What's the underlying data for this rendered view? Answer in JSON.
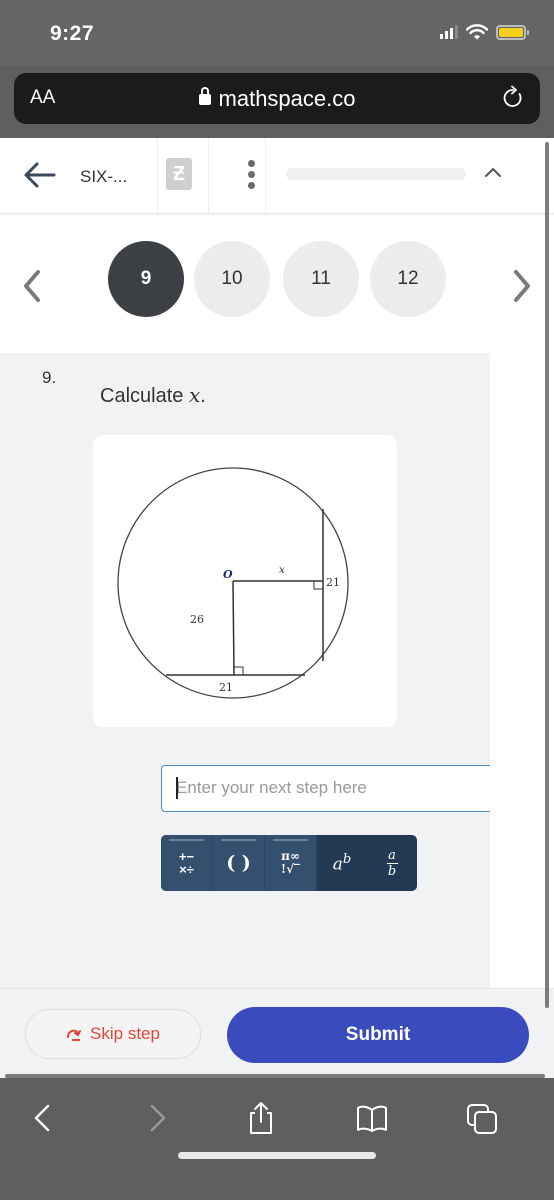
{
  "status_bar": {
    "time": "9:27",
    "battery_color": "#f5cf1c"
  },
  "browser": {
    "text_size_label": "AA",
    "url": "mathspace.co"
  },
  "topnav": {
    "topic": "SIX-...",
    "app_icon_glyph": "Ƶ"
  },
  "question_nav": {
    "items": [
      {
        "label": "9",
        "active": true
      },
      {
        "label": "10",
        "active": false
      },
      {
        "label": "11",
        "active": false
      },
      {
        "label": "12",
        "active": false
      }
    ]
  },
  "question": {
    "number": "9.",
    "prompt": "Calculate",
    "variable": "x",
    "prompt_end": ".",
    "figure": {
      "center_label": "O",
      "unknown_label": "x",
      "radius_label": "26",
      "bottom_chord_half_label": "21",
      "right_chord_half_label": "21"
    }
  },
  "answer": {
    "placeholder": "Enter your next step here",
    "value": ""
  },
  "keyboard": {
    "tabs": [
      {
        "name": "operators",
        "line1": "+−",
        "line2": "×÷"
      },
      {
        "name": "brackets",
        "label": "( )"
      },
      {
        "name": "symbols",
        "line1": "π∞",
        "line2": "!√‾"
      }
    ],
    "power": {
      "base": "a",
      "exp": "b"
    },
    "fraction": {
      "num": "a",
      "den": "b"
    }
  },
  "footer": {
    "skip_label": "Skip step",
    "submit_label": "Submit",
    "skip_color": "#e0463a",
    "submit_color": "#3a4cbd"
  }
}
